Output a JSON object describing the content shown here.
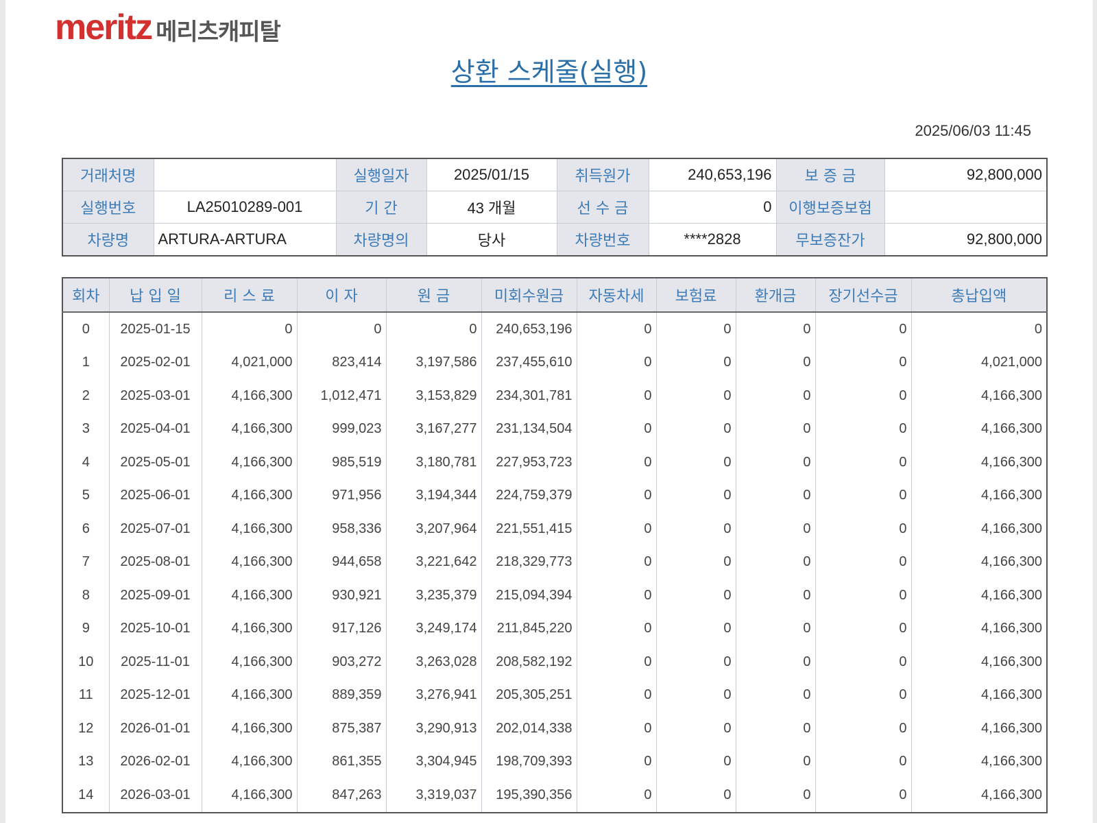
{
  "logo": {
    "brand": "meritz",
    "company": "메리츠캐피탈"
  },
  "title": "상환 스케줄(실행)",
  "timestamp": "2025/06/03 11:45",
  "info": {
    "client_label": "거래처명",
    "client_value": "",
    "exec_date_label": "실행일자",
    "exec_date_value": "2025/01/15",
    "acq_price_label": "취득원가",
    "acq_price_value": "240,653,196",
    "deposit_label": "보 증 금",
    "deposit_value": "92,800,000",
    "exec_no_label": "실행번호",
    "exec_no_value": "LA25010289-001",
    "period_label": "기 간",
    "period_value": "43 개월",
    "advance_label": "선 수 금",
    "advance_value": "0",
    "insurance_label": "이행보증보험",
    "insurance_value": "",
    "vehicle_label": "차량명",
    "vehicle_value": "ARTURA-ARTURA",
    "owner_label": "차량명의",
    "owner_value": "당사",
    "plate_label": "차량번호",
    "plate_value": "****2828",
    "residual_label": "무보증잔가",
    "residual_value": "92,800,000"
  },
  "schedule": {
    "headers": [
      "회차",
      "납 입 일",
      "리 스 료",
      "이 자",
      "원 금",
      "미회수원금",
      "자동차세",
      "보험료",
      "환개금",
      "장기선수금",
      "총납입액"
    ],
    "rows": [
      [
        "0",
        "2025-01-15",
        "0",
        "0",
        "0",
        "240,653,196",
        "0",
        "0",
        "0",
        "0",
        "0"
      ],
      [
        "1",
        "2025-02-01",
        "4,021,000",
        "823,414",
        "3,197,586",
        "237,455,610",
        "0",
        "0",
        "0",
        "0",
        "4,021,000"
      ],
      [
        "2",
        "2025-03-01",
        "4,166,300",
        "1,012,471",
        "3,153,829",
        "234,301,781",
        "0",
        "0",
        "0",
        "0",
        "4,166,300"
      ],
      [
        "3",
        "2025-04-01",
        "4,166,300",
        "999,023",
        "3,167,277",
        "231,134,504",
        "0",
        "0",
        "0",
        "0",
        "4,166,300"
      ],
      [
        "4",
        "2025-05-01",
        "4,166,300",
        "985,519",
        "3,180,781",
        "227,953,723",
        "0",
        "0",
        "0",
        "0",
        "4,166,300"
      ],
      [
        "5",
        "2025-06-01",
        "4,166,300",
        "971,956",
        "3,194,344",
        "224,759,379",
        "0",
        "0",
        "0",
        "0",
        "4,166,300"
      ],
      [
        "6",
        "2025-07-01",
        "4,166,300",
        "958,336",
        "3,207,964",
        "221,551,415",
        "0",
        "0",
        "0",
        "0",
        "4,166,300"
      ],
      [
        "7",
        "2025-08-01",
        "4,166,300",
        "944,658",
        "3,221,642",
        "218,329,773",
        "0",
        "0",
        "0",
        "0",
        "4,166,300"
      ],
      [
        "8",
        "2025-09-01",
        "4,166,300",
        "930,921",
        "3,235,379",
        "215,094,394",
        "0",
        "0",
        "0",
        "0",
        "4,166,300"
      ],
      [
        "9",
        "2025-10-01",
        "4,166,300",
        "917,126",
        "3,249,174",
        "211,845,220",
        "0",
        "0",
        "0",
        "0",
        "4,166,300"
      ],
      [
        "10",
        "2025-11-01",
        "4,166,300",
        "903,272",
        "3,263,028",
        "208,582,192",
        "0",
        "0",
        "0",
        "0",
        "4,166,300"
      ],
      [
        "11",
        "2025-12-01",
        "4,166,300",
        "889,359",
        "3,276,941",
        "205,305,251",
        "0",
        "0",
        "0",
        "0",
        "4,166,300"
      ],
      [
        "12",
        "2026-01-01",
        "4,166,300",
        "875,387",
        "3,290,913",
        "202,014,338",
        "0",
        "0",
        "0",
        "0",
        "4,166,300"
      ],
      [
        "13",
        "2026-02-01",
        "4,166,300",
        "861,355",
        "3,304,945",
        "198,709,393",
        "0",
        "0",
        "0",
        "0",
        "4,166,300"
      ],
      [
        "14",
        "2026-03-01",
        "4,166,300",
        "847,263",
        "3,319,037",
        "195,390,356",
        "0",
        "0",
        "0",
        "0",
        "4,166,300"
      ]
    ]
  },
  "colors": {
    "brand_red": "#d2312f",
    "title_blue": "#2a6fa8",
    "label_blue": "#3d7bb7",
    "label_bg": "#e4e6ec"
  }
}
